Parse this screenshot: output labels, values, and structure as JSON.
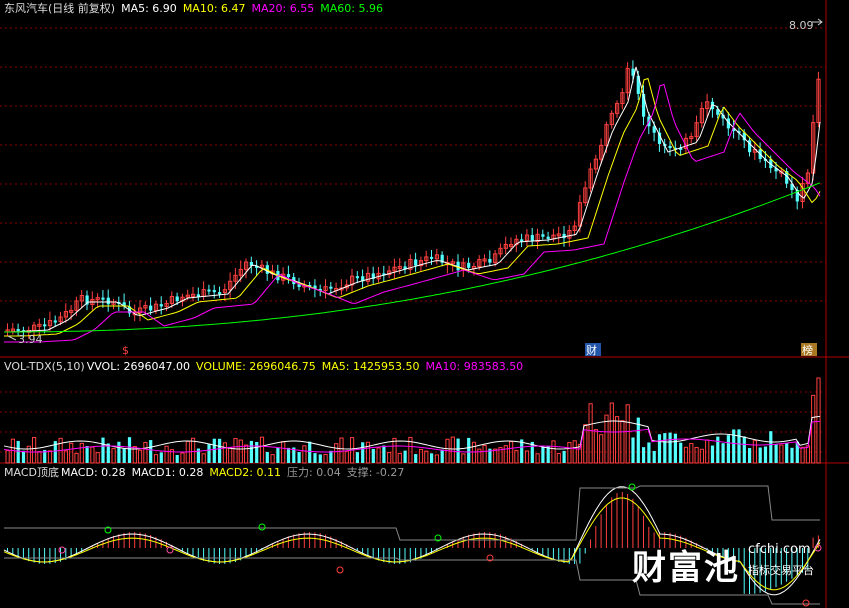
{
  "main_panel": {
    "title": "东风汽车(日线 前复权)",
    "ma5": "MA5: 6.90",
    "ma10": "MA10: 6.47",
    "ma20": "MA20: 6.55",
    "ma60": "MA60: 5.96",
    "high_label": "8.09",
    "low_label": "3.94",
    "markers": [
      "$",
      "财",
      "榜"
    ]
  },
  "volume_panel": {
    "title": "VOL-TDX(5,10)",
    "vvol": "VVOL: 2696047.00",
    "volume": "VOLUME: 2696046.75",
    "ma5": "MA5: 1425953.50",
    "ma10": "MA10: 983583.50"
  },
  "macd_panel": {
    "title": "MACD顶底",
    "macd": "MACD: 0.28",
    "macd1": "MACD1: 0.28",
    "macd2": "MACD2: 0.11",
    "pressure": "压力: 0.04",
    "support": "支撑: -0.27"
  },
  "watermark": {
    "brand": "财富池",
    "site": "cfchi.com",
    "slogan": "指标交易平台"
  },
  "colors": {
    "up": "#ff4040",
    "down": "#54ffff",
    "ma5": "#ffffff",
    "ma10": "#ffff00",
    "ma20": "#ff00ff",
    "ma60": "#00ff00",
    "grid": "#8b0000"
  }
}
